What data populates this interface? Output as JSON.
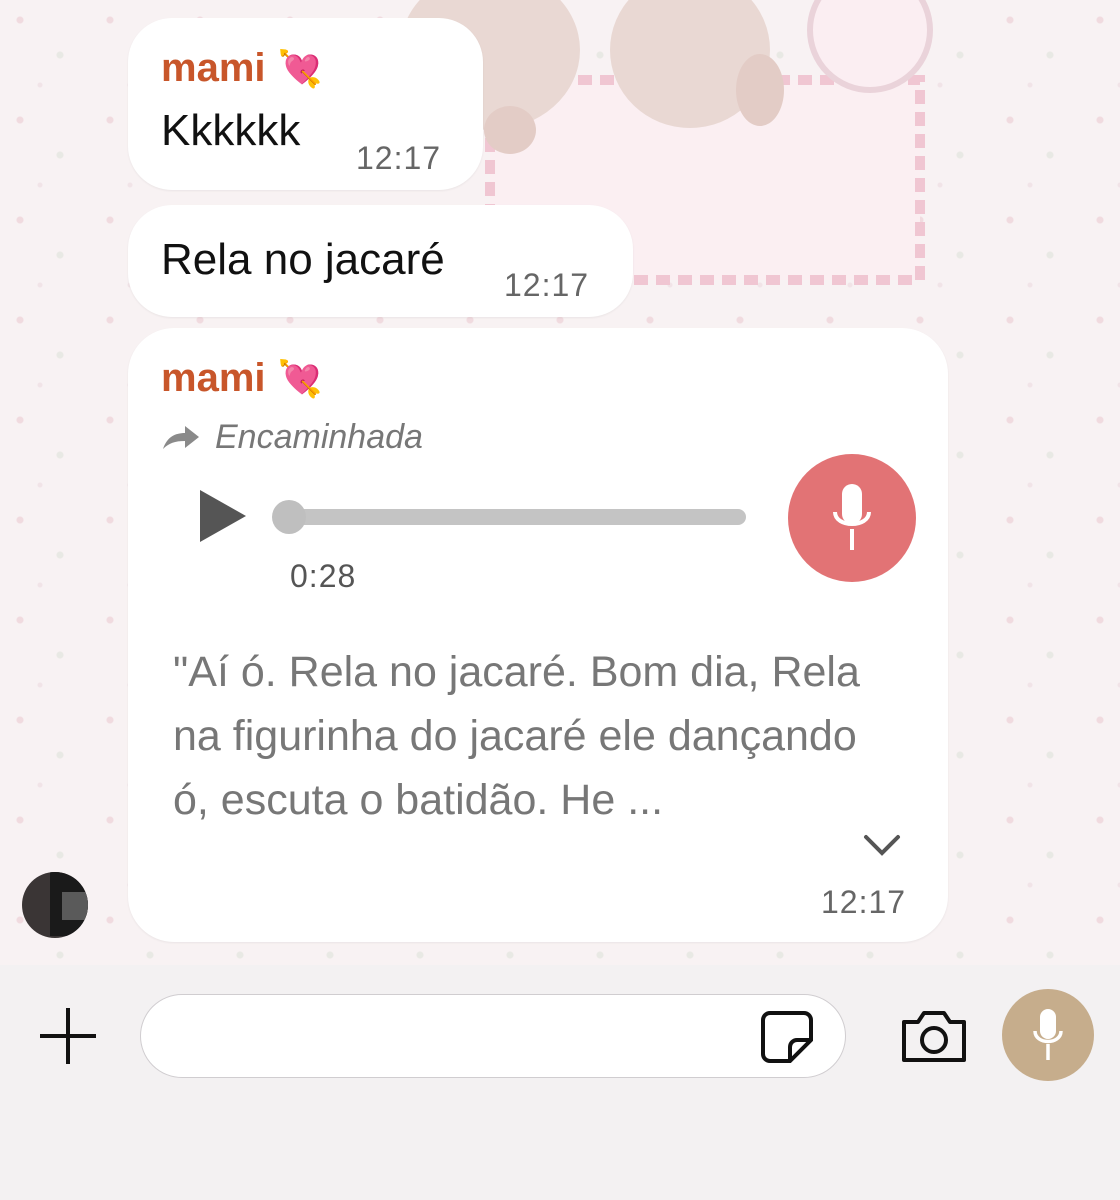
{
  "messages": [
    {
      "sender": "mami",
      "heart_emoji": "💘",
      "text": "Kkkkkk",
      "time": "12:17"
    },
    {
      "text": "Rela no jacaré",
      "time": "12:17"
    },
    {
      "sender": "mami",
      "heart_emoji": "💘",
      "forwarded_label": "Encaminhada",
      "audio": {
        "duration": "0:28",
        "progress": 0
      },
      "transcript": "\"Aí ó. Rela no jacaré. Bom dia, Rela na figurinha do jacaré ele dançando ó, escuta o batidão. He  ...",
      "time": "12:17"
    }
  ],
  "colors": {
    "sender": "#c8562a",
    "voice_badge": "#e27375",
    "mic_button": "#c6ad8c"
  },
  "icons": [
    "forward-icon",
    "play-icon",
    "microphone-icon",
    "chevron-down-icon",
    "plus-icon",
    "sticker-icon",
    "camera-icon"
  ]
}
